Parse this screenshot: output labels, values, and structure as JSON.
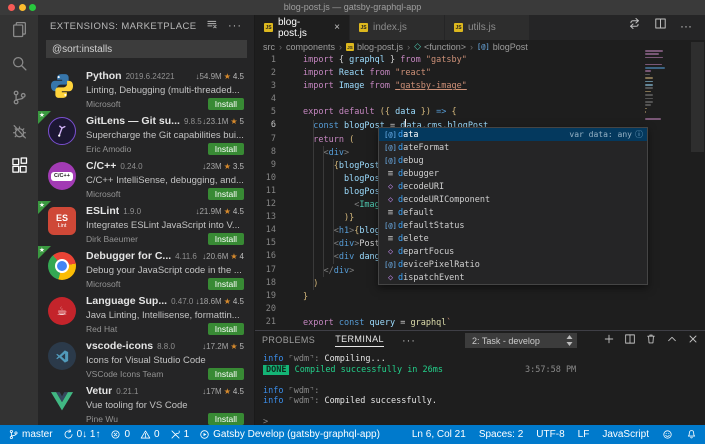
{
  "window": {
    "title": "blog-post.js — gatsby-graphql-app"
  },
  "colors": {
    "accent": "#007acc",
    "install_green": "#388a34",
    "done_green": "#14b476"
  },
  "activity_bar": {
    "items": [
      {
        "name": "explorer-icon",
        "active": false
      },
      {
        "name": "search-icon",
        "active": false
      },
      {
        "name": "source-control-icon",
        "active": false
      },
      {
        "name": "debug-icon",
        "active": false
      },
      {
        "name": "extensions-icon",
        "active": true
      }
    ]
  },
  "sidebar": {
    "header": "EXTENSIONS: MARKETPLACE",
    "search_value": "@sort:installs",
    "extensions": [
      {
        "name": "Python",
        "version": "2019.6.24221",
        "downloads": "54.9M",
        "rating": "4.5",
        "description": "Linting, Debugging (multi-threaded...",
        "author": "Microsoft",
        "install_label": "Install",
        "icon": "python",
        "ribbon": false
      },
      {
        "name": "GitLens — Git su...",
        "version": "9.8.5",
        "downloads": "23.1M",
        "rating": "5",
        "description": "Supercharge the Git capabilities bui...",
        "author": "Eric Amodio",
        "install_label": "Install",
        "icon": "gitlens",
        "ribbon": true
      },
      {
        "name": "C/C++",
        "version": "0.24.0",
        "downloads": "23M",
        "rating": "3.5",
        "description": "C/C++ IntelliSense, debugging, and...",
        "author": "Microsoft",
        "install_label": "Install",
        "icon": "cpp",
        "ribbon": false
      },
      {
        "name": "ESLint",
        "version": "1.9.0",
        "downloads": "21.9M",
        "rating": "4.5",
        "description": "Integrates ESLint JavaScript into V...",
        "author": "Dirk Baeumer",
        "install_label": "Install",
        "icon": "eslint",
        "ribbon": true
      },
      {
        "name": "Debugger for C...",
        "version": "4.11.6",
        "downloads": "20.6M",
        "rating": "4",
        "description": "Debug your JavaScript code in the ...",
        "author": "Microsoft",
        "install_label": "Install",
        "icon": "chrome",
        "ribbon": true
      },
      {
        "name": "Language Sup...",
        "version": "0.47.0",
        "downloads": "18.6M",
        "rating": "4.5",
        "description": "Java Linting, Intellisense, formattin...",
        "author": "Red Hat",
        "install_label": "Install",
        "icon": "redhat",
        "ribbon": false
      },
      {
        "name": "vscode-icons",
        "version": "8.8.0",
        "downloads": "17.2M",
        "rating": "5",
        "description": "Icons for Visual Studio Code",
        "author": "VSCode Icons Team",
        "install_label": "Install",
        "icon": "vsicons",
        "ribbon": false
      },
      {
        "name": "Vetur",
        "version": "0.21.1",
        "downloads": "17M",
        "rating": "4.5",
        "description": "Vue tooling for VS Code",
        "author": "Pine Wu",
        "install_label": "Install",
        "icon": "vetur",
        "ribbon": false
      }
    ]
  },
  "editor": {
    "tabs": [
      {
        "label": "blog-post.js",
        "active": true
      },
      {
        "label": "index.js",
        "active": false
      },
      {
        "label": "utils.js",
        "active": false
      }
    ],
    "breadcrumb": [
      {
        "label": "src"
      },
      {
        "label": "components"
      },
      {
        "label": "blog-post.js",
        "icon": "js"
      },
      {
        "label": "<function>",
        "icon": "method"
      },
      {
        "label": "blogPost",
        "icon": "variable"
      }
    ],
    "active_line": 6,
    "code_lines": [
      [
        [
          "import",
          "kw"
        ],
        [
          " {",
          "p"
        ],
        [
          " graphql",
          "var"
        ],
        [
          " }",
          "p"
        ],
        [
          " from",
          "kw"
        ],
        [
          " \"gatsby\"",
          "str"
        ]
      ],
      [
        [
          "import",
          "kw"
        ],
        [
          " React",
          "var"
        ],
        [
          " from",
          "kw"
        ],
        [
          " \"react\"",
          "str"
        ]
      ],
      [
        [
          "import",
          "kw"
        ],
        [
          " Image",
          "var"
        ],
        [
          " from",
          "kw"
        ],
        [
          " ",
          "p"
        ],
        [
          "\"gatsby-image\"",
          "lnk"
        ]
      ],
      [],
      [
        [
          "export",
          "kw"
        ],
        [
          " default",
          "kw"
        ],
        [
          " (",
          "gold"
        ],
        [
          "{",
          "gold"
        ],
        [
          " data",
          "var"
        ],
        [
          " }",
          "gold"
        ],
        [
          ")",
          "gold"
        ],
        [
          " =>",
          "kw2"
        ],
        [
          " {",
          "gold"
        ]
      ],
      [
        [
          "  ",
          "p"
        ],
        [
          "const",
          "kw2"
        ],
        [
          " blogPost",
          "var"
        ],
        [
          " =",
          "p"
        ],
        [
          " d",
          "var"
        ],
        [
          "",
          "cursor"
        ],
        [
          "ata.cms.blogPost",
          "var"
        ]
      ],
      [
        [
          "  ",
          "p"
        ],
        [
          "return",
          "kw"
        ],
        [
          " (",
          "gold"
        ]
      ],
      [
        [
          "    ",
          "p"
        ],
        [
          "<",
          "tag"
        ],
        [
          "div",
          "kw2"
        ],
        [
          ">",
          "tag"
        ]
      ],
      [
        [
          "      ",
          "p"
        ],
        [
          "{",
          "gold"
        ],
        [
          "blogPost",
          "var"
        ]
      ],
      [
        [
          "        blogPos",
          "var"
        ]
      ],
      [
        [
          "        blogPos",
          "var"
        ]
      ],
      [
        [
          "          ",
          "p"
        ],
        [
          "<",
          "tag"
        ],
        [
          "Imag",
          "cmp"
        ]
      ],
      [
        [
          "        ",
          "p"
        ],
        [
          ")}",
          "gold"
        ]
      ],
      [
        [
          "      ",
          "p"
        ],
        [
          "<",
          "tag"
        ],
        [
          "h1",
          "kw2"
        ],
        [
          ">",
          "tag"
        ],
        [
          "{",
          "gold"
        ],
        [
          "blog",
          "var"
        ]
      ],
      [
        [
          "      ",
          "p"
        ],
        [
          "<",
          "tag"
        ],
        [
          "div",
          "kw2"
        ],
        [
          ">",
          "tag"
        ],
        [
          "Post",
          "p"
        ]
      ],
      [
        [
          "      ",
          "p"
        ],
        [
          "<",
          "tag"
        ],
        [
          "div",
          "kw2"
        ],
        [
          " dang",
          "var"
        ]
      ],
      [
        [
          "    ",
          "p"
        ],
        [
          "</",
          "tag"
        ],
        [
          "div",
          "kw2"
        ],
        [
          ">",
          "tag"
        ]
      ],
      [
        [
          "  )",
          "gold"
        ]
      ],
      [
        [
          "}",
          "gold"
        ]
      ],
      [],
      [
        [
          "export",
          "kw"
        ],
        [
          " const",
          "kw2"
        ],
        [
          " query",
          "var"
        ],
        [
          " =",
          "p"
        ],
        [
          " graphql",
          "fn"
        ],
        [
          "`",
          "str"
        ]
      ]
    ],
    "suggest": {
      "match_prefix": "d",
      "items": [
        {
          "label": "data",
          "kind": "variable",
          "selected": true,
          "detail": "var data: any"
        },
        {
          "label": "dateFormat",
          "kind": "variable"
        },
        {
          "label": "debug",
          "kind": "variable"
        },
        {
          "label": "debugger",
          "kind": "keyword"
        },
        {
          "label": "decodeURI",
          "kind": "method"
        },
        {
          "label": "decodeURIComponent",
          "kind": "method"
        },
        {
          "label": "default",
          "kind": "keyword"
        },
        {
          "label": "defaultStatus",
          "kind": "variable"
        },
        {
          "label": "delete",
          "kind": "keyword"
        },
        {
          "label": "departFocus",
          "kind": "method"
        },
        {
          "label": "devicePixelRatio",
          "kind": "variable"
        },
        {
          "label": "dispatchEvent",
          "kind": "method"
        }
      ]
    }
  },
  "panel": {
    "tabs": [
      {
        "label": "PROBLEMS",
        "active": false
      },
      {
        "label": "TERMINAL",
        "active": true
      }
    ],
    "more": "⋯",
    "task_selector": "2: Task - develop",
    "terminal_lines": [
      {
        "tokens": [
          [
            "info",
            "ti"
          ],
          [
            " ⌜wdm⌝",
            "td"
          ],
          [
            ": ",
            "td"
          ],
          [
            "Compiling...",
            "tw"
          ]
        ]
      },
      {
        "tokens": [
          [
            "DONE",
            "tdone"
          ],
          [
            " ",
            "tw"
          ],
          [
            "Compiled successfully in 26ms",
            "tg"
          ]
        ],
        "right": "3:57:58 PM"
      },
      {
        "tokens": []
      },
      {
        "tokens": [
          [
            "info",
            "ti"
          ],
          [
            " ⌜wdm⌝",
            "td"
          ],
          [
            ":",
            "td"
          ]
        ]
      },
      {
        "tokens": [
          [
            "info",
            "ti"
          ],
          [
            " ⌜wdm⌝",
            "td"
          ],
          [
            ": ",
            "td"
          ],
          [
            "Compiled successfully.",
            "tw"
          ]
        ]
      },
      {
        "tokens": []
      },
      {
        "tokens": [
          [
            ">",
            "td"
          ]
        ]
      }
    ]
  },
  "status_bar": {
    "left": [
      {
        "icon": "git-branch-icon",
        "text": "master"
      },
      {
        "icon": "sync-icon",
        "text": "0↓ 1↑"
      },
      {
        "icon": "error-icon",
        "text": "0"
      },
      {
        "icon": "warning-icon",
        "text": "0"
      },
      {
        "icon": "tools-icon",
        "text": "1"
      },
      {
        "icon": "play-circle-icon",
        "text": "Gatsby Develop (gatsby-graphql-app)"
      }
    ],
    "right": [
      {
        "text": "Ln 6, Col 21"
      },
      {
        "text": "Spaces: 2"
      },
      {
        "text": "UTF-8"
      },
      {
        "text": "LF"
      },
      {
        "text": "JavaScript"
      },
      {
        "icon": "feedback-smiley-icon"
      },
      {
        "icon": "bell-icon"
      }
    ]
  }
}
